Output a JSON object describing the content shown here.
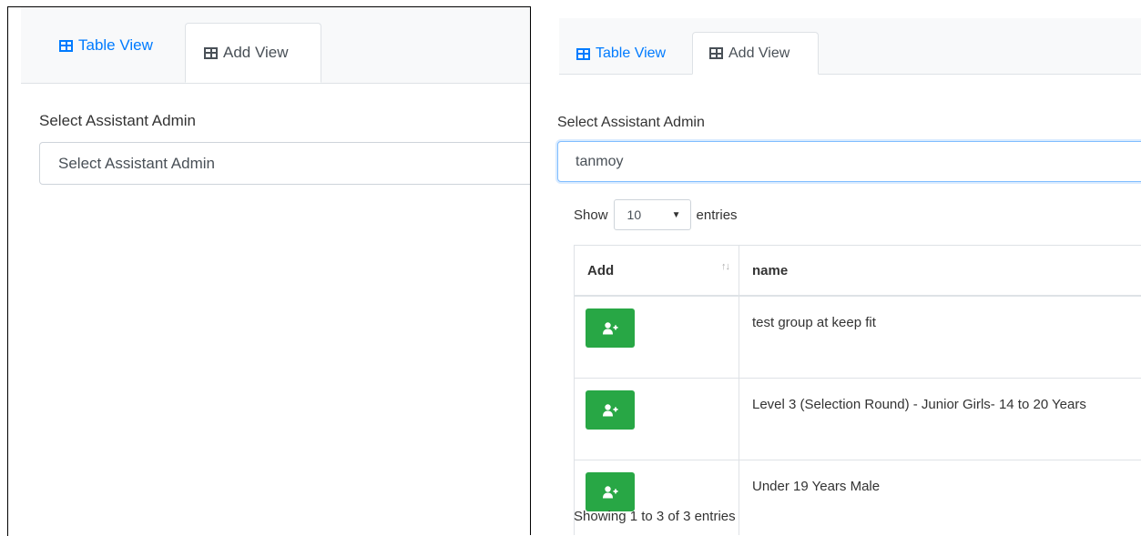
{
  "left_panel": {
    "tabs": [
      {
        "label": "Table View",
        "active": false,
        "icon": "table-icon"
      },
      {
        "label": "Add View",
        "active": true,
        "icon": "table-icon"
      }
    ],
    "field_label": "Select Assistant Admin",
    "select_value": "Select Assistant Admin"
  },
  "right_panel": {
    "tabs": [
      {
        "label": "Table View",
        "active": false,
        "icon": "table-icon"
      },
      {
        "label": "Add View",
        "active": true,
        "icon": "table-icon"
      }
    ],
    "field_label": "Select Assistant Admin",
    "select_value": "tanmoy",
    "length": {
      "prefix": "Show",
      "value": "10",
      "suffix": "entries"
    },
    "table": {
      "columns": [
        "Add",
        "name"
      ],
      "rows": [
        {
          "name": "test group at keep fit"
        },
        {
          "name": "Level 3 (Selection Round) - Junior Girls- 14 to 20 Years"
        },
        {
          "name": "Under 19 Years Male"
        }
      ]
    },
    "info": "Showing 1 to 3 of 3 entries"
  },
  "colors": {
    "primary": "#007bff",
    "success": "#28a745",
    "border": "#dee2e6",
    "focus": "#80bdff"
  }
}
